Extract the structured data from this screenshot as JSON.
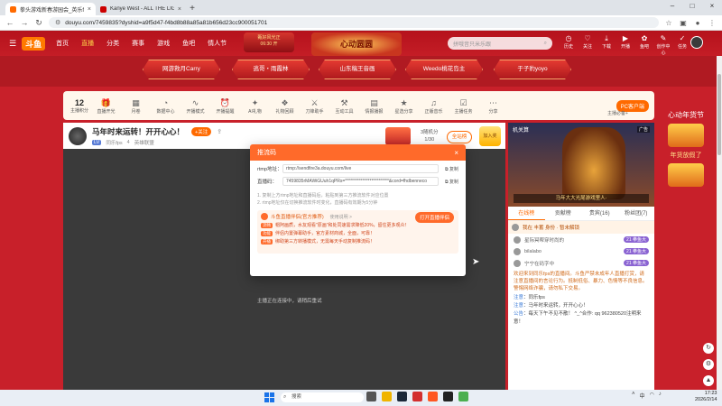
{
  "browser": {
    "tabs": [
      {
        "title": "拳头游戏新春游园会_英乐fps直",
        "active": true
      },
      {
        "title": "Kanye West - ALL THE LIGHTS",
        "active": false
      }
    ],
    "url": "douyu.com/7459835?dyshid=a9f5d47-f4bd8b88a85a81b656d23cc900051701"
  },
  "site": {
    "nav": [
      "首页",
      "直播",
      "分类",
      "赛事",
      "游戏",
      "鱼吧",
      "情人节"
    ],
    "banner_text": "甄好风光正\n06:30 开",
    "banner_center": "心动圆圆",
    "search_placeholder": "拼哦音只米乐跟",
    "header_icons": [
      {
        "icon": "history-icon",
        "label": "历史"
      },
      {
        "icon": "follow-icon",
        "label": "关注"
      },
      {
        "icon": "download-icon",
        "label": "下载"
      },
      {
        "icon": "live-icon",
        "label": "开播"
      },
      {
        "icon": "pet-icon",
        "label": "鱼吧"
      },
      {
        "icon": "create-icon",
        "label": "创作中心"
      },
      {
        "icon": "task-icon",
        "label": "任务"
      }
    ]
  },
  "streamers": [
    "网游救月Carry",
    "逃哥・雨霞林",
    "山东稿王音画",
    "Weedo桃花岛主",
    "于子豹yoyo"
  ],
  "toolbar": {
    "count": "12",
    "count_label": "主播积分",
    "items": [
      "直播开光",
      "月卷",
      "数据中心",
      "开播模式",
      "开播提醒",
      "AI礼物",
      "礼物回顾",
      "刀锋助手",
      "互动工具",
      "情报播报",
      "星选分享",
      "正版音乐",
      "主播任务",
      "分享"
    ],
    "pc_label": "PC客户端",
    "pc_sub": "主播必备+"
  },
  "stream": {
    "title": "马年时来运转！开开心心！",
    "level": "LV",
    "streamer": "同乐fps",
    "fans": "4",
    "category": "英雄联盟",
    "follow": "+关注",
    "rank_text": "3随机分\n1/30",
    "fanclub": "全站榜",
    "gold": "加入奖"
  },
  "player": {
    "message": "主播正在连接中，请稍后重试"
  },
  "modal": {
    "title": "推流码",
    "rtmp_label": "rtmp地址：",
    "rtmp_value": "rtmp://sendfire3a.douyu.com/live",
    "code_label": "直播码：",
    "code_value": "7459835rMAWiGUuh1qPRs=*************************&cord=fhdbenneco",
    "copy_label": "复制",
    "tips": [
      "1. 复制上方rtmp地址和直播码后，粘贴到第三方推流软件对应位置",
      "2. rtmp地址仅在切换推流软件时变化，直播码有效期为5分钟"
    ],
    "promo_title": "斗鱼直播伴侣(官方推荐)",
    "promo_sub": "使用说明 >",
    "open_btn": "打开直播伴侣",
    "promo_lines": [
      {
        "tag": "流畅",
        "text": "帽阿画质，水友观看\"原画\"和处同速需求降低20%，留住更多观众！"
      },
      {
        "tag": "功能",
        "text": "伴侣内置弹幕助手，官方素材商城，全面，可靠！"
      },
      {
        "tag": "开播",
        "text": "绑助第三方转播模式，无需每天手动复制推流码！"
      }
    ]
  },
  "sidebar": {
    "video_label": "机关算",
    "video_caption": "马年大大光尾游戏里人·",
    "ad": "广告",
    "tabs": [
      "在线榜",
      "贡献榜",
      "贵宾(16)",
      "粉丝团(7)"
    ],
    "chat_head": "我在 丰蓄 身份 · 暂未解锁",
    "fans": [
      {
        "name": "星际冥帮穿时尚的",
        "badge": "21 拳鱼大"
      },
      {
        "name": "bilalabo",
        "badge": "21 拳鱼大"
      },
      {
        "name": "宁宁在码字中",
        "badge": "21 拳鱼大"
      }
    ],
    "notice": "欢迎来到同乐fps的直播间。斗鱼严禁未成年人直播打赏，请注意直播间的言论行为。抵制低俗、暴力、色情等不良信息。警惕网络诈骗，请勿私下交易。",
    "chats": [
      {
        "user": "注意",
        "text": "同乐fps"
      },
      {
        "user": "注意",
        "text": "马年时来运转，开开心心！"
      },
      {
        "user": "公告",
        "text": "每天下午不见不散！ ^_^合作: qq 962380520注明来意！"
      }
    ]
  },
  "festival": {
    "title": "心动年货节",
    "sub": "年货放假了"
  },
  "taskbar": {
    "search": "搜索",
    "time": "17:23",
    "date": "2026/2/14"
  },
  "colors": {
    "page_red": "#c8202a",
    "accent_orange": "#ff6a2a"
  }
}
